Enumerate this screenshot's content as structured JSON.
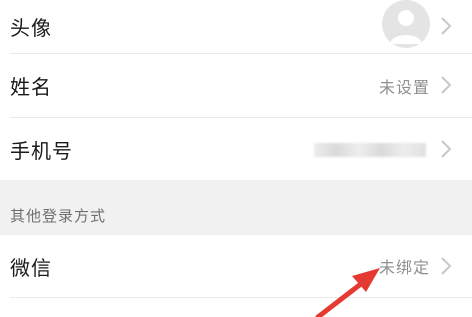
{
  "profile": {
    "avatar_label": "头像",
    "name_label": "姓名",
    "name_value": "未设置",
    "phone_label": "手机号",
    "phone_value": ""
  },
  "other_login": {
    "section_title": "其他登录方式",
    "wechat_label": "微信",
    "wechat_value": "未绑定"
  },
  "icons": {
    "chevron": "chevron-right-icon",
    "avatar": "default-avatar-icon",
    "annotation": "red-arrow-annotation"
  },
  "colors": {
    "label": "#1a1a1a",
    "value": "#8f8f8f",
    "section_bg": "#f1f1f1",
    "arrow": "#e53a32"
  }
}
